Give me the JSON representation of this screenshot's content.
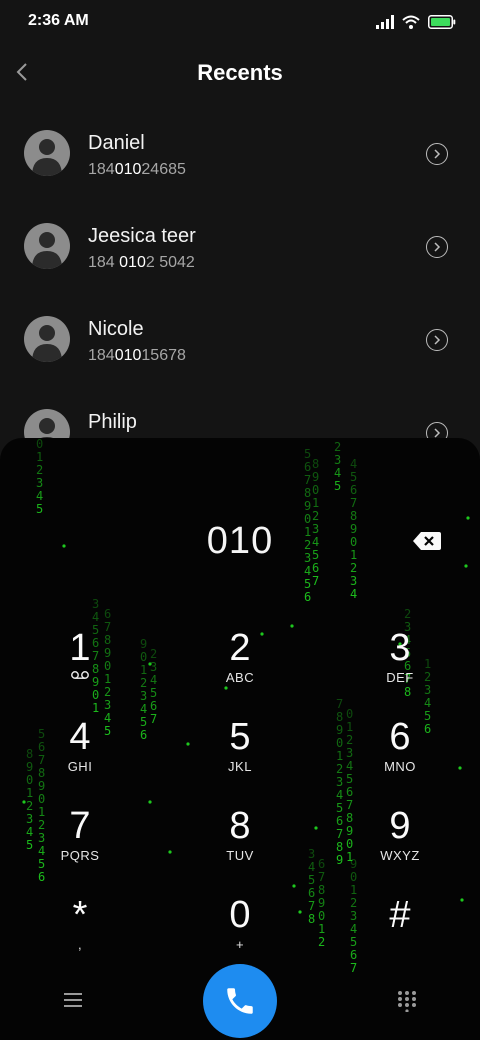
{
  "status_bar": {
    "time": "2:36 AM",
    "icons": [
      "signal-icon",
      "wifi-icon",
      "battery-icon"
    ],
    "battery_color": "#3ddc5c"
  },
  "header": {
    "title": "Recents",
    "back_icon": "chevron-left-icon"
  },
  "contacts": [
    {
      "name": "Daniel",
      "number": "18401024685",
      "match": "010"
    },
    {
      "name": "Jeesica teer",
      "number": "184 0102 5042",
      "match": "010"
    },
    {
      "name": "Nicole",
      "number": "18401015678",
      "match": "010"
    },
    {
      "name": "Philip",
      "number": "",
      "match": ""
    }
  ],
  "dialpad": {
    "dialed_number": "010",
    "backspace_icon": "backspace-icon",
    "keys": [
      {
        "digit": "1",
        "letters": "",
        "sub_icon": "voicemail-icon"
      },
      {
        "digit": "2",
        "letters": "ABC"
      },
      {
        "digit": "3",
        "letters": "DEF"
      },
      {
        "digit": "4",
        "letters": "GHI"
      },
      {
        "digit": "5",
        "letters": "JKL"
      },
      {
        "digit": "6",
        "letters": "MNO"
      },
      {
        "digit": "7",
        "letters": "PQRS"
      },
      {
        "digit": "8",
        "letters": "TUV"
      },
      {
        "digit": "9",
        "letters": "WXYZ"
      },
      {
        "digit": "*",
        "letters": ","
      },
      {
        "digit": "0",
        "letters": "+"
      },
      {
        "digit": "#",
        "letters": ""
      }
    ]
  },
  "bottom_bar": {
    "menu_icon": "menu-icon",
    "call_icon": "phone-icon",
    "call_color": "#1e8cf0",
    "keypad_icon": "dialpad-icon"
  },
  "theme": {
    "background": "#141414",
    "dialpad_background": "#040404",
    "matrix_color": "#1ec81e"
  }
}
